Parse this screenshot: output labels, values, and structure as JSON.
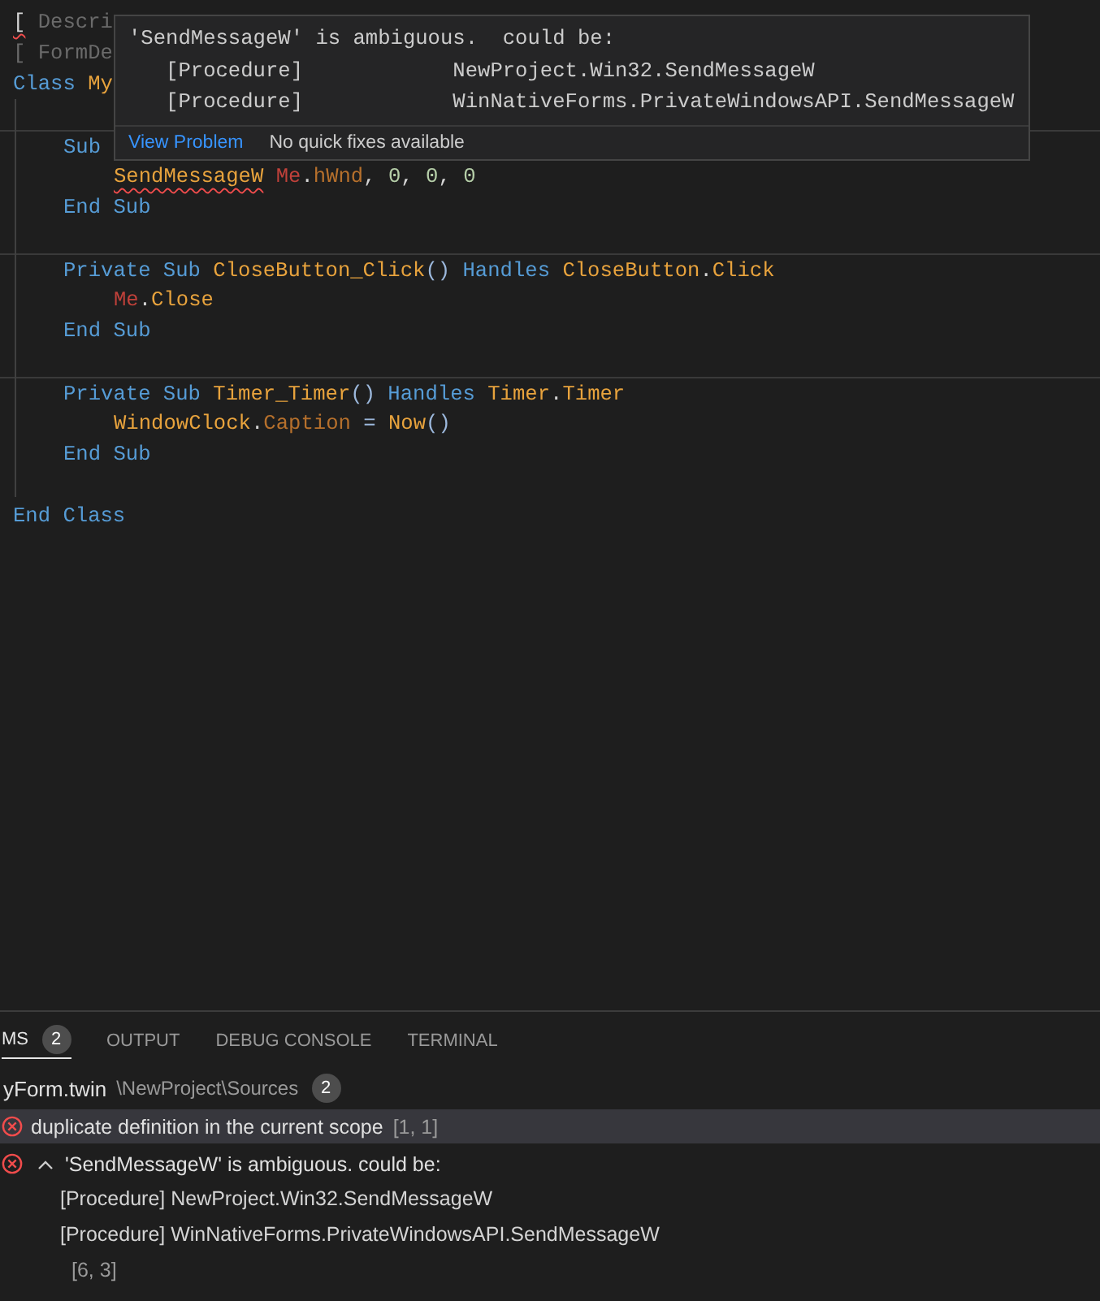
{
  "editor": {
    "lines": [
      {
        "kind": "top",
        "tokens": [
          {
            "text": "[",
            "kind": "plain",
            "error": true
          },
          {
            "text": " Descri",
            "kind": "comment"
          }
        ]
      },
      {
        "kind": "top",
        "tokens": [
          {
            "text": "[ FormDe",
            "kind": "comment"
          }
        ]
      },
      {
        "kind": "top",
        "tokens": [
          {
            "text": "Class ",
            "kind": "keyword"
          },
          {
            "text": "My",
            "kind": "ident"
          }
        ]
      },
      {
        "kind": "top"
      },
      {
        "kind": "member",
        "separator_above": true,
        "tokens": [
          {
            "text": "Sub",
            "kind": "keyword"
          }
        ]
      },
      {
        "kind": "body",
        "tokens": [
          {
            "text": "SendMessageW",
            "kind": "ident",
            "error": true
          },
          {
            "text": " Me",
            "kind": "me"
          },
          {
            "text": ".",
            "kind": "plain"
          },
          {
            "text": "hWnd",
            "kind": "prop"
          },
          {
            "text": ", ",
            "kind": "plain"
          },
          {
            "text": "0",
            "kind": "number"
          },
          {
            "text": ", ",
            "kind": "plain"
          },
          {
            "text": "0",
            "kind": "number"
          },
          {
            "text": ", ",
            "kind": "plain"
          },
          {
            "text": "0",
            "kind": "number"
          }
        ]
      },
      {
        "kind": "member",
        "tokens": [
          {
            "text": "End Sub",
            "kind": "keyword"
          }
        ]
      },
      {
        "kind": "member"
      },
      {
        "kind": "member",
        "separator_above": true,
        "tokens": [
          {
            "text": "Private Sub ",
            "kind": "keyword"
          },
          {
            "text": "CloseButton_Click",
            "kind": "ident"
          },
          {
            "text": "()",
            "kind": "punct"
          },
          {
            "text": " Handles ",
            "kind": "keyword"
          },
          {
            "text": "CloseButton",
            "kind": "ident"
          },
          {
            "text": ".",
            "kind": "plain"
          },
          {
            "text": "Click",
            "kind": "ident"
          }
        ]
      },
      {
        "kind": "body",
        "tokens": [
          {
            "text": "Me",
            "kind": "me"
          },
          {
            "text": ".",
            "kind": "plain"
          },
          {
            "text": "Close",
            "kind": "ident"
          }
        ]
      },
      {
        "kind": "member",
        "tokens": [
          {
            "text": "End Sub",
            "kind": "keyword"
          }
        ]
      },
      {
        "kind": "member"
      },
      {
        "kind": "member",
        "separator_above": true,
        "tokens": [
          {
            "text": "Private Sub ",
            "kind": "keyword"
          },
          {
            "text": "Timer_Timer",
            "kind": "ident"
          },
          {
            "text": "()",
            "kind": "punct"
          },
          {
            "text": " Handles ",
            "kind": "keyword"
          },
          {
            "text": "Timer",
            "kind": "ident"
          },
          {
            "text": ".",
            "kind": "plain"
          },
          {
            "text": "Timer",
            "kind": "ident"
          }
        ]
      },
      {
        "kind": "body",
        "tokens": [
          {
            "text": "WindowClock",
            "kind": "ident"
          },
          {
            "text": ".",
            "kind": "plain"
          },
          {
            "text": "Caption",
            "kind": "prop"
          },
          {
            "text": " = ",
            "kind": "punct"
          },
          {
            "text": "Now",
            "kind": "ident"
          },
          {
            "text": "()",
            "kind": "punct"
          }
        ]
      },
      {
        "kind": "member",
        "tokens": [
          {
            "text": "End Sub",
            "kind": "keyword"
          }
        ]
      },
      {
        "kind": "member"
      },
      {
        "kind": "top",
        "tokens": [
          {
            "text": "End Class",
            "kind": "keyword"
          }
        ]
      }
    ]
  },
  "hover": {
    "lines": [
      "'SendMessageW' is ambiguous.  could be:",
      "   [Procedure]            NewProject.Win32.SendMessageW",
      "   [Procedure]            WinNativeForms.PrivateWindowsAPI.SendMessageW"
    ],
    "link": "View Problem",
    "note": "No quick fixes available"
  },
  "panel": {
    "tabs": [
      {
        "label": "MS",
        "badge": "2",
        "selected": true
      },
      {
        "label": "OUTPUT",
        "selected": false
      },
      {
        "label": "DEBUG CONSOLE",
        "selected": false
      },
      {
        "label": "TERMINAL",
        "selected": false
      }
    ],
    "file": {
      "name": "yForm.twin",
      "path": "\\NewProject\\Sources",
      "count": "2"
    },
    "problems": [
      {
        "message": "duplicate definition in the current scope",
        "location": "[1, 1]",
        "selected": true,
        "expanded": false
      },
      {
        "message": "'SendMessageW' is ambiguous. could be:",
        "location": "[6, 3]",
        "selected": false,
        "expanded": true,
        "details": [
          "[Procedure] NewProject.Win32.SendMessageW",
          "[Procedure] WinNativeForms.PrivateWindowsAPI.SendMessageW"
        ]
      }
    ]
  }
}
